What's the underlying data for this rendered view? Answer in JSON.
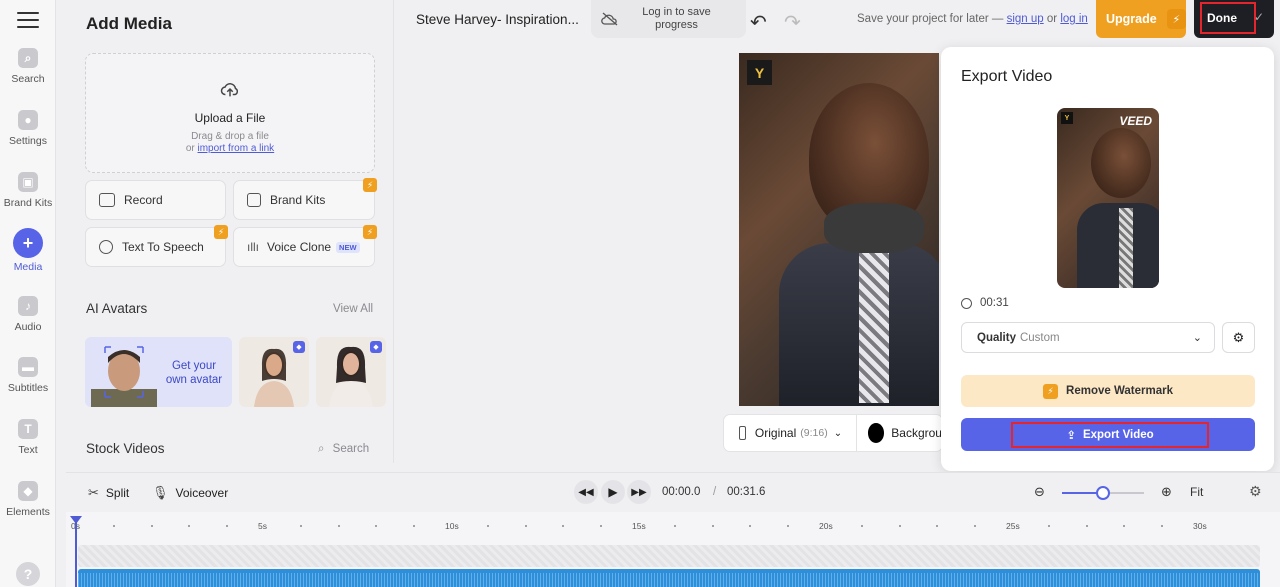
{
  "rail": {
    "items": [
      {
        "label": "Search",
        "icon": "search-icon"
      },
      {
        "label": "Settings",
        "icon": "settings-icon"
      },
      {
        "label": "Brand Kits",
        "icon": "brand-kits-icon"
      },
      {
        "label": "Media",
        "icon": "plus-icon"
      },
      {
        "label": "Audio",
        "icon": "music-icon"
      },
      {
        "label": "Subtitles",
        "icon": "subtitles-icon"
      },
      {
        "label": "Text",
        "icon": "text-icon"
      },
      {
        "label": "Elements",
        "icon": "elements-icon"
      }
    ],
    "help": "?"
  },
  "panel": {
    "title": "Add Media",
    "upload": {
      "title": "Upload a File",
      "hint": "Drag & drop a file",
      "or": "or",
      "link": "import from a link"
    },
    "tiles": {
      "record": "Record",
      "brand_kits": "Brand Kits",
      "tts": "Text To Speech",
      "voice_clone": "Voice Clone",
      "new_tag": "NEW"
    },
    "ai_avatars": {
      "title": "AI Avatars",
      "view_all": "View All",
      "get_your_line1": "Get your",
      "get_your_line2": "own avatar"
    },
    "stock_videos": {
      "title": "Stock Videos",
      "search": "Search"
    }
  },
  "topbar": {
    "project_title": "Steve Harvey- Inspiration...",
    "save_pill_line1": "Log in to save",
    "save_pill_line2": "progress",
    "save_later": "Save your project for later —",
    "sign_up": "sign up",
    "or": "or",
    "log_in": "log in",
    "upgrade": "Upgrade",
    "done": "Done"
  },
  "canvas": {
    "ratio_label": "Original",
    "ratio_sub": "(9:16)",
    "background_label": "Backgrou"
  },
  "export": {
    "title": "Export Video",
    "brand": "VEED",
    "duration": "00:31",
    "quality_label": "Quality",
    "quality_value": "Custom",
    "remove_watermark": "Remove Watermark",
    "export_button": "Export Video"
  },
  "toolbar": {
    "split": "Split",
    "voiceover": "Voiceover",
    "current_time": "00:00.0",
    "separator": "/",
    "total_time": "00:31.6",
    "fit": "Fit",
    "zoom_level": 0.5
  },
  "timeline": {
    "labels": [
      "0s",
      "5s",
      "10s",
      "15s",
      "20s",
      "25s",
      "30s"
    ]
  },
  "colors": {
    "accent": "#5764e8",
    "upgrade": "#f0a020",
    "highlight": "#e4262c"
  }
}
